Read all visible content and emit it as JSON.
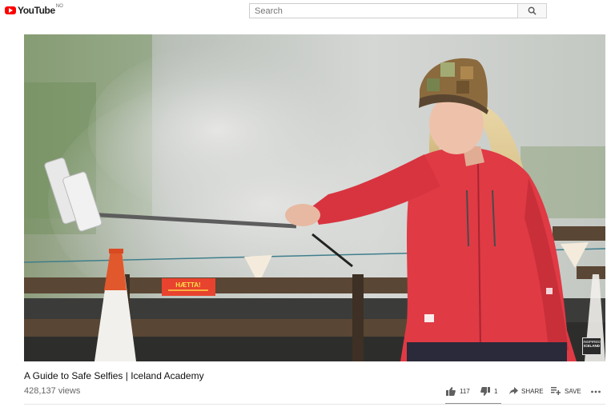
{
  "header": {
    "logo_text": "YouTube",
    "logo_region": "NO",
    "search_placeholder": "Search"
  },
  "video": {
    "title": "A Guide to Safe Selfies | Iceland Academy",
    "views": "428,137 views",
    "sign_text": "HÆTTA!",
    "watermark_line1": "INSPIRED",
    "watermark_line2": "ICELAND"
  },
  "actions": {
    "likes": "117",
    "dislikes": "1",
    "share_label": "SHARE",
    "save_label": "SAVE"
  },
  "colors": {
    "brand_red": "#ff0000",
    "jacket_red": "#e03a45"
  }
}
